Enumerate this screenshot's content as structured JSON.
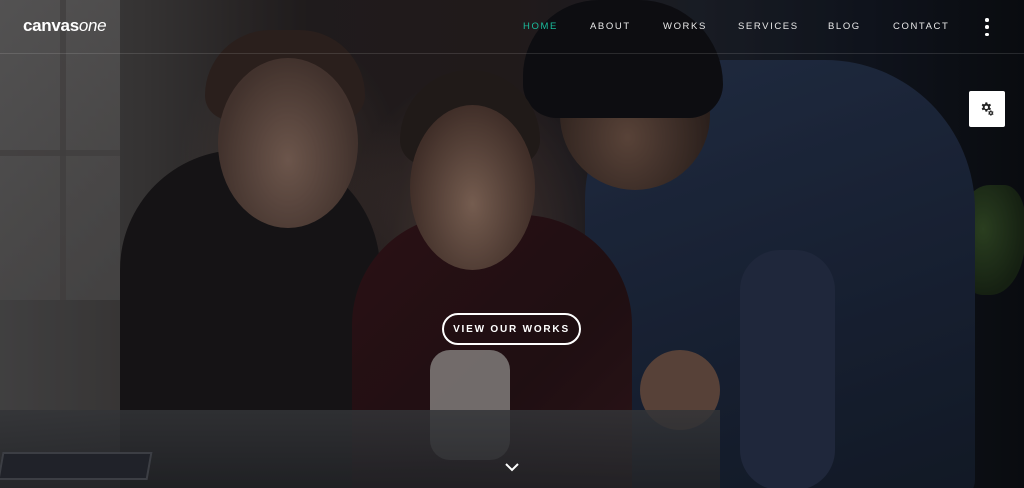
{
  "brand": {
    "name_bold": "canvas",
    "name_italic": "one"
  },
  "nav": {
    "items": [
      {
        "label": "HOME",
        "active": true
      },
      {
        "label": "ABOUT",
        "active": false
      },
      {
        "label": "WORKS",
        "active": false
      },
      {
        "label": "SERVICES",
        "active": false
      },
      {
        "label": "BLOG",
        "active": false
      },
      {
        "label": "CONTACT",
        "active": false
      }
    ],
    "more_icon": "vertical-dots-icon"
  },
  "settings": {
    "icon": "gear-icon"
  },
  "hero": {
    "cta_label": "VIEW OUR WORKS",
    "scroll_icon": "chevron-down-icon"
  },
  "colors": {
    "accent": "#1abc9c",
    "text": "#ffffff"
  }
}
